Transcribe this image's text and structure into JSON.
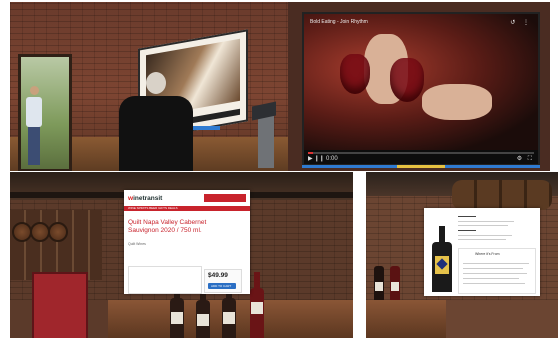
{
  "scene": "Virtual winery showroom collage",
  "top_right_video": {
    "title": "Bold Eating - Join Rhythm",
    "controls_left": "▶ ❙❙ 0:00",
    "controls_right": "⚙ ⛶",
    "progress": 0.02
  },
  "listing_card": {
    "brand_prefix": "w",
    "brand_rest": "inetransit",
    "nav_text": "WINE   SPIRITS   BEER   GIFTS   DEALS",
    "product_title": "Quilt Napa Valley Cabernet Sauvignon 2020 / 750 ml.",
    "price": "$49.99",
    "add_to_cart": "ADD TO CART",
    "sub_label": "Quilt Wines"
  },
  "product_card": {
    "where_title": "Where it's From"
  }
}
